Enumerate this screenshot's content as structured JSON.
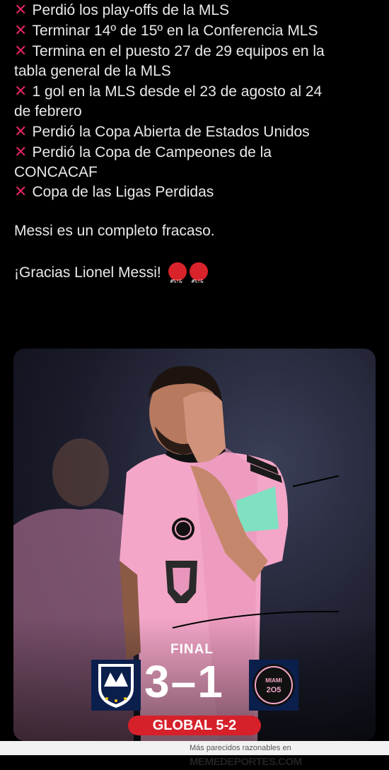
{
  "post": {
    "items": [
      {
        "line1": "Perdió los play-offs de la MLS"
      },
      {
        "line1": "Terminar 14º de 15º en la Conferencia MLS"
      },
      {
        "line1": "Termina en el puesto 27 de 29 equipos en la",
        "line2": "tabla general de la MLS"
      },
      {
        "line1": "1 gol en la MLS desde el 23 de agosto al 24",
        "line2": "de febrero"
      },
      {
        "line1": "Perdió la Copa Abierta de Estados Unidos"
      },
      {
        "line1": "Perdió la Copa de Campeones de la",
        "line2": "CONCACAF"
      },
      {
        "line1": "Copa de las Ligas Perdidas"
      }
    ],
    "bullet_icon": "cross-mark-icon",
    "paragraph1": "Messi es un completo fracaso.",
    "paragraph2": "¡Gracias Lionel Messi!",
    "emoji_icon": "face-with-symbols-on-mouth-icon",
    "colors": {
      "background": "#000000",
      "text": "#e7e9ea",
      "cross": "#e0245e"
    }
  },
  "media": {
    "final_label": "FINAL",
    "home_score": "3",
    "dash": "–",
    "away_score": "1",
    "global_label": "GLOBAL 5-2",
    "home_crest_icon": "monterrey-crest-icon",
    "away_crest_icon": "inter-miami-crest-icon",
    "away_crest_text": "MIAMI",
    "away_crest_year": "2O5",
    "colors": {
      "jersey": "#f4a6c8",
      "global_badge": "#d6202a"
    }
  },
  "footer": {
    "text": "Más parecidos razonables en",
    "brand": "MEMEDEPORTES.COM"
  }
}
